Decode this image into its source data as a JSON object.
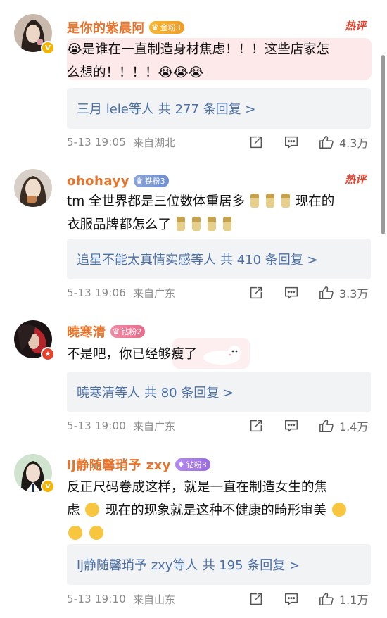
{
  "comments": [
    {
      "username": "是你的紫晨阿",
      "fan_badge": "金粉3",
      "hot_tag": "热评",
      "text_lines": [
        "😭是谁在一直制造身材焦虑！！！这些店家怎",
        "么想的！！！！😭😭😭"
      ],
      "reply_summary": {
        "user": "三月 lele",
        "suffix": "等人",
        "count_text": "共 277 条回复 >"
      },
      "time": "5-13 19:05",
      "location": "来自湖北",
      "likes": "4.3万"
    },
    {
      "username": "ohohayy",
      "fan_badge": "铁粉3",
      "hot_tag": "热评",
      "text_lines": [
        "tm 全世界都是三位数体重居多",
        "衣服品牌都怎么了"
      ],
      "text_tail": "现在的",
      "reply_summary": {
        "user": "追星不能太真情实感",
        "suffix": "等人",
        "count_text": "共 410 条回复 >"
      },
      "time": "5-13 19:06",
      "location": "来自广东",
      "likes": "3.3万"
    },
    {
      "username": "曉寒清",
      "fan_badge": "钻粉2",
      "text_lines": [
        "不是吧，你已经够瘦了"
      ],
      "reply_summary": {
        "user": "曉寒清",
        "suffix": "等人",
        "count_text": "共 80 条回复 >"
      },
      "time": "5-13 19:00",
      "location": "来自广东",
      "likes": "1.4万"
    },
    {
      "username": "lj静随馨琑予 zxy",
      "fan_badge": "钻粉3",
      "text_lines": [
        "反正尺码卷成这样，就是一直在制造女生的焦",
        "虑",
        "现在的现象就是这种不健康的畸形审美"
      ],
      "reply_summary": {
        "user": "lj静随馨琑予 zxy",
        "suffix": "等人",
        "count_text": "共 195 条回复 >"
      },
      "time": "5-13 19:10",
      "location": "来自山东",
      "likes": "1.1万"
    }
  ],
  "colors": {
    "username": "#e8742c",
    "hot_tag": "#e8412c",
    "reply_link": "#4a6fa5",
    "meta": "#8a8a8a"
  },
  "icons": {
    "share": "share-icon",
    "comment": "comment-icon",
    "like": "thumbs-up-icon"
  }
}
